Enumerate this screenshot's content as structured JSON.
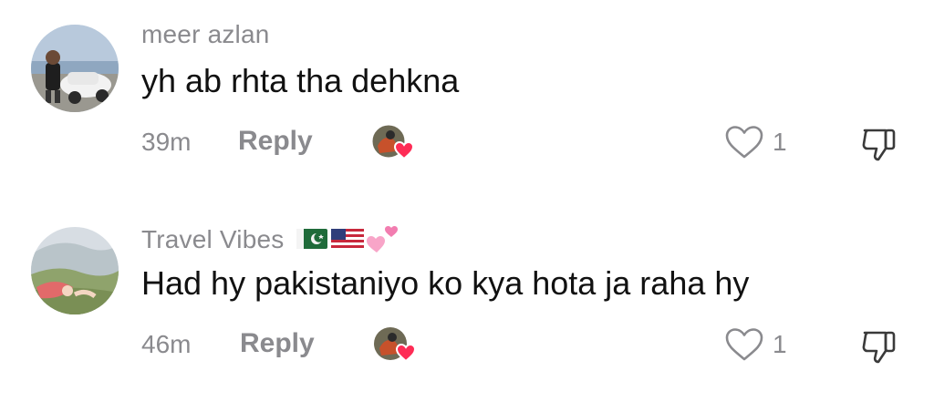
{
  "comments": [
    {
      "username": "meer azlan",
      "text": "yh ab rhta tha dehkna",
      "time": "39m",
      "reply_label": "Reply",
      "likes": "1",
      "avatar": "avatar-boy-with-toy-car"
    },
    {
      "username": "Travel Vibes",
      "username_badges": [
        "pakistan-flag-icon",
        "usa-flag-icon",
        "pink-hearts-icon"
      ],
      "text": "Had hy pakistaniyo ko kya hota ja raha hy",
      "time": "46m",
      "reply_label": "Reply",
      "likes": "1",
      "avatar": "avatar-landscape"
    }
  ],
  "icons": {
    "like": "heart-outline-icon",
    "dislike": "thumbs-down-icon",
    "creator_liked": "creator-liked-heart-icon"
  },
  "colors": {
    "muted_text": "#8a8a8e",
    "body_text": "#111111",
    "heart_badge": "#fe2c55"
  }
}
